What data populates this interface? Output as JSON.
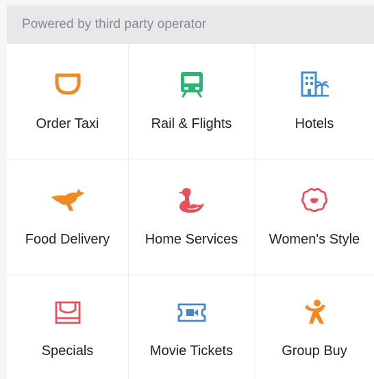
{
  "header": {
    "text": "Powered by third party operator"
  },
  "services": [
    {
      "label": "Order Taxi",
      "icon": "taxi-icon",
      "color": "#f08a22"
    },
    {
      "label": "Rail & Flights",
      "icon": "train-icon",
      "color": "#2bb673"
    },
    {
      "label": "Hotels",
      "icon": "hotel-icon",
      "color": "#3c8fd6"
    },
    {
      "label": "Food Delivery",
      "icon": "kangaroo-icon",
      "color": "#f08a22"
    },
    {
      "label": "Home Services",
      "icon": "swan-icon",
      "color": "#e8505b"
    },
    {
      "label": "Women's Style",
      "icon": "flower-icon",
      "color": "#e8505b"
    },
    {
      "label": "Specials",
      "icon": "tray-icon",
      "color": "#e8505b"
    },
    {
      "label": "Movie Tickets",
      "icon": "ticket-icon",
      "color": "#4a86c5"
    },
    {
      "label": "Group Buy",
      "icon": "group-buy-icon",
      "color": "#f08a22"
    }
  ]
}
